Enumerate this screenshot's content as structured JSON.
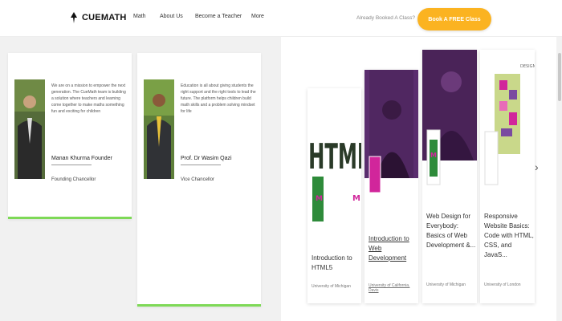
{
  "nav": {
    "logo": "CUEMATH",
    "links": [
      "Math",
      "About Us",
      "Become a Teacher",
      "More"
    ],
    "cta_text": "Already Booked A Class?",
    "cta_button": "Book A FREE Class"
  },
  "leaders": [
    {
      "quote": "We are on a mission to empower the next generation. The CueMath team is building a solution where teachers and learning come together to make maths something fun and exciting for children",
      "name": "Manan Khurma Founder",
      "role": "Founding Chancellor"
    },
    {
      "quote": "Education is all about giving students the right support and the right tools to lead the future. The platform helps children build math skills and a problem solving mindset for life",
      "name": "Prof. Dr Wasim Qazi",
      "role": "Vice Chancellor"
    }
  ],
  "courses": [
    {
      "title": "Introduction to HTML5",
      "provider": "University of Michigan"
    },
    {
      "title": "Introduction to Web Development",
      "provider": "University of California, Davis"
    },
    {
      "title": "Web Design for Everybody: Basics of Web Development &...",
      "provider": "University of Michigan"
    },
    {
      "title": "Responsive Website Basics: Code with HTML, CSS, and JavaS...",
      "provider": "University of London"
    }
  ],
  "colors": {
    "cta": "#fbb321",
    "leader_bar": "#7ed957",
    "course_purple": "#5a2d6e",
    "course_magenta": "#d1269b",
    "course_green": "#2e8b3a"
  }
}
